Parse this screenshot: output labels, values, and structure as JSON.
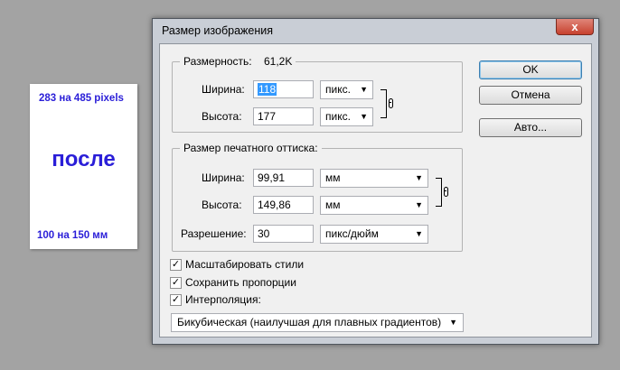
{
  "preview": {
    "pixels_label": "283 на 485 pixels",
    "word": "после",
    "mm_label": "100 на 150 мм"
  },
  "dialog": {
    "title": "Размер изображения",
    "close_glyph": "x",
    "pixel_dimensions": {
      "label": "Размерность:",
      "size": "61,2K",
      "width_label": "Ширина:",
      "width_value": "118",
      "width_unit": "пикс.",
      "height_label": "Высота:",
      "height_value": "177",
      "height_unit": "пикс."
    },
    "document_size": {
      "legend": "Размер печатного оттиска:",
      "width_label": "Ширина:",
      "width_value": "99,91",
      "width_unit": "мм",
      "height_label": "Высота:",
      "height_value": "149,86",
      "height_unit": "мм",
      "resolution_label": "Разрешение:",
      "resolution_value": "30",
      "resolution_unit": "пикс/дюйм"
    },
    "buttons": {
      "ok": "OK",
      "cancel": "Отмена",
      "auto": "Авто..."
    },
    "checkboxes": [
      {
        "label": "Масштабировать стили",
        "checked_glyph": "✓"
      },
      {
        "label": "Сохранить пропорции",
        "checked_glyph": "✓"
      },
      {
        "label": "Интерполяция:",
        "checked_glyph": "✓"
      }
    ],
    "resample_method": "Бикубическая (наилучшая для плавных градиентов)",
    "arrow_glyph": "▼"
  }
}
